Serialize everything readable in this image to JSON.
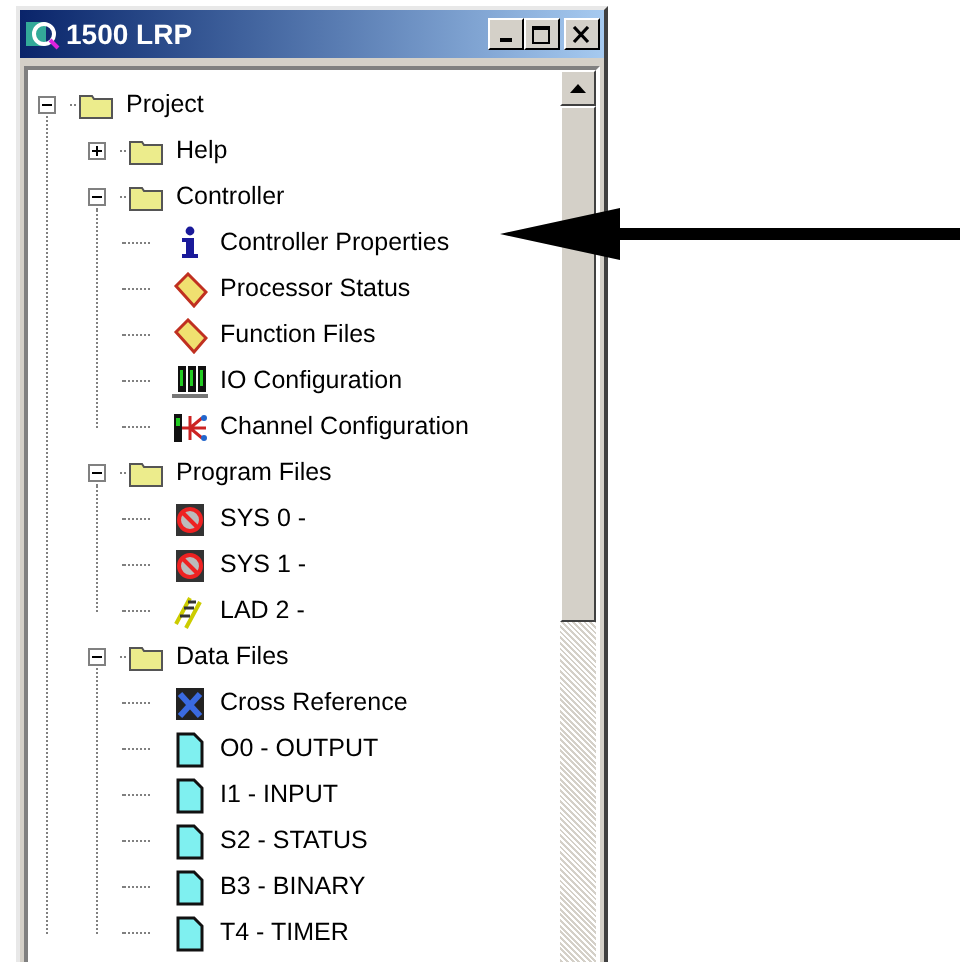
{
  "window": {
    "title": "1500 LRP"
  },
  "tree": [
    {
      "label": "Project",
      "kind": "folder",
      "expanded": true,
      "children": [
        {
          "label": "Help",
          "kind": "folder",
          "expanded": false
        },
        {
          "label": "Controller",
          "kind": "folder",
          "expanded": true,
          "children": [
            {
              "label": "Controller Properties",
              "kind": "info"
            },
            {
              "label": "Processor Status",
              "kind": "status"
            },
            {
              "label": "Function Files",
              "kind": "status"
            },
            {
              "label": "IO Configuration",
              "kind": "io"
            },
            {
              "label": "Channel Configuration",
              "kind": "channel"
            }
          ]
        },
        {
          "label": "Program Files",
          "kind": "folder",
          "expanded": true,
          "children": [
            {
              "label": "SYS 0 -",
              "kind": "system"
            },
            {
              "label": "SYS 1 -",
              "kind": "system"
            },
            {
              "label": "LAD 2 -",
              "kind": "ladder"
            }
          ]
        },
        {
          "label": "Data Files",
          "kind": "folder",
          "expanded": true,
          "children": [
            {
              "label": "Cross Reference",
              "kind": "crossref"
            },
            {
              "label": "O0 - OUTPUT",
              "kind": "datafile"
            },
            {
              "label": "I1 - INPUT",
              "kind": "datafile"
            },
            {
              "label": "S2 - STATUS",
              "kind": "datafile"
            },
            {
              "label": "B3 - BINARY",
              "kind": "datafile"
            },
            {
              "label": "T4 - TIMER",
              "kind": "datafile"
            }
          ]
        }
      ]
    }
  ]
}
